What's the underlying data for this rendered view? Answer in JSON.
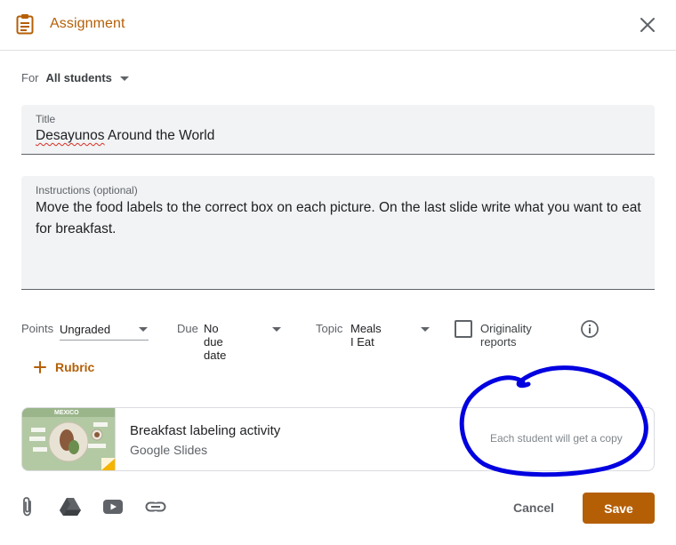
{
  "header": {
    "icon": "assignment-clipboard-icon",
    "title": "Assignment",
    "close_icon": "close-icon"
  },
  "assign_to": {
    "label": "For",
    "value": "All students"
  },
  "title_field": {
    "label": "Title",
    "value_misspelled": "Desayunos",
    "value_rest": " Around the World"
  },
  "instructions_field": {
    "label": "Instructions (optional)",
    "value": "Move the food labels to the correct box on each picture. On the last slide write what you want to eat for breakfast."
  },
  "options": {
    "points": {
      "label": "Points",
      "value": "Ungraded"
    },
    "due": {
      "label": "Due",
      "value": "No due date"
    },
    "topic": {
      "label": "Topic",
      "value": "Meals I Eat"
    },
    "originality": {
      "label": "Originality reports",
      "checked": false,
      "icon": "info-icon"
    }
  },
  "rubric": {
    "label": "Rubric",
    "icon": "plus-icon"
  },
  "attachment": {
    "title": "Breakfast labeling activity",
    "type": "Google Slides",
    "note": "Each student will get a copy",
    "thumbnail_text": "MEXICO"
  },
  "footer": {
    "icons": [
      "paperclip-icon",
      "google-drive-icon",
      "youtube-icon",
      "link-icon"
    ],
    "cancel_label": "Cancel",
    "save_label": "Save"
  },
  "colors": {
    "accent": "#b45f06",
    "annotation": "#0000e0",
    "field_bg": "#f1f3f4"
  }
}
